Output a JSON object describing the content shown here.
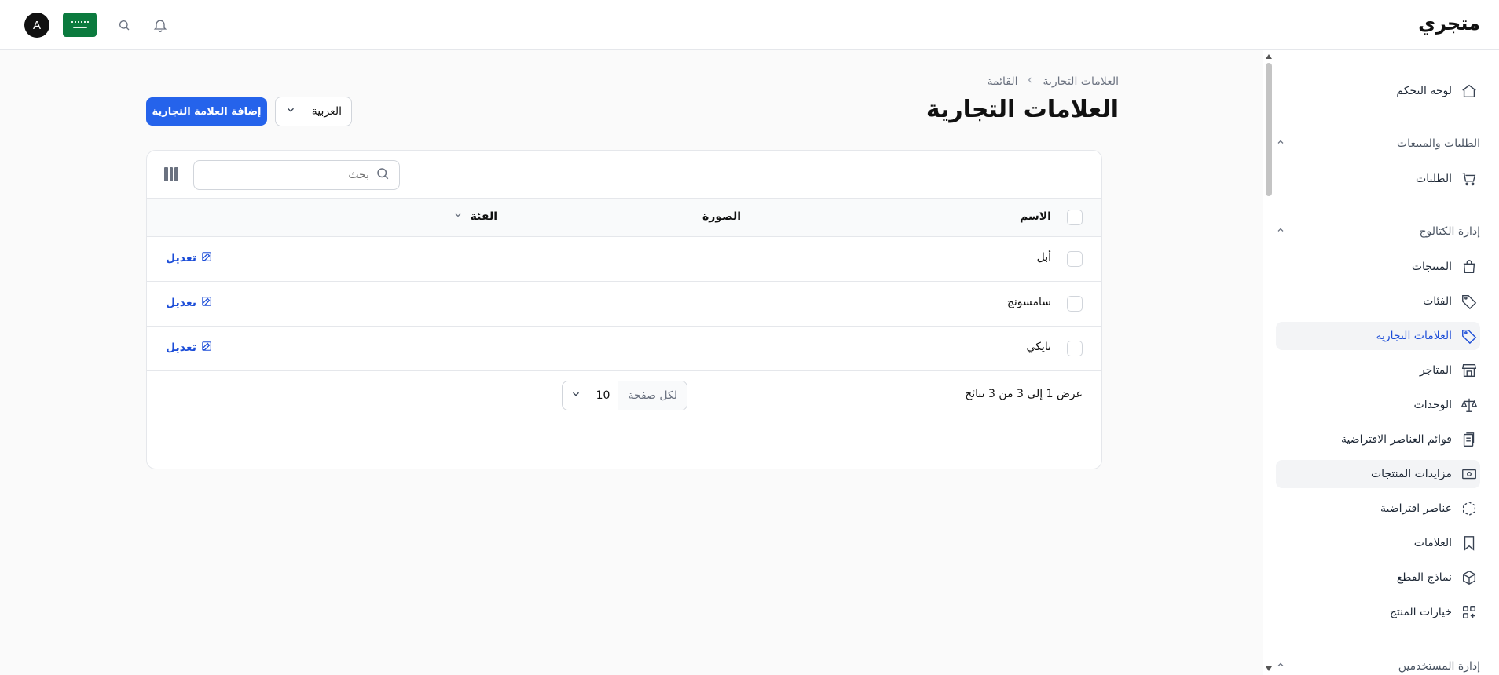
{
  "topbar": {
    "brand": "متجري",
    "avatar_initial": "A",
    "flag": "saudi-flag"
  },
  "sidebar": {
    "items": [
      {
        "label": "لوحة التحكم",
        "icon": "home-icon"
      },
      {
        "group": "الطلبات والمبيعات"
      },
      {
        "label": "الطلبات",
        "icon": "cart-icon"
      },
      {
        "group": "إدارة الكتالوج"
      },
      {
        "label": "المنتجات",
        "icon": "bag-icon"
      },
      {
        "label": "الفئات",
        "icon": "tag-icon"
      },
      {
        "label": "العلامات التجارية",
        "icon": "tag-icon",
        "active": true
      },
      {
        "label": "المتاجر",
        "icon": "store-icon"
      },
      {
        "label": "الوحدات",
        "icon": "scale-icon"
      },
      {
        "label": "قوائم العناصر الافتراضية",
        "icon": "clipboard-icon"
      },
      {
        "label": "مزايدات المنتجات",
        "icon": "money-icon"
      },
      {
        "label": "عناصر افتراضية",
        "icon": "cube-dashed-icon"
      },
      {
        "label": "العلامات",
        "icon": "bookmark-icon"
      },
      {
        "label": "نماذج القطع",
        "icon": "box-icon"
      },
      {
        "label": "خيارات المنتج",
        "icon": "grid-plus-icon"
      },
      {
        "group": "إدارة المستخدمين"
      }
    ]
  },
  "breadcrumb": {
    "parent": "العلامات التجارية",
    "current": "القائمة"
  },
  "page": {
    "title": "العلامات التجارية",
    "add_button": "إضافة العلامة التجارية",
    "language": "العربية"
  },
  "table": {
    "search_placeholder": "بحث",
    "columns": {
      "name": "الاسم",
      "image": "الصورة",
      "category": "الفئة"
    },
    "edit_label": "تعديل",
    "rows": [
      {
        "name": "أبل"
      },
      {
        "name": "سامسونج"
      },
      {
        "name": "نايكي"
      }
    ],
    "footer": {
      "results": "عرض 1 إلى 3 من 3 نتائج",
      "per_page_label": "لكل صفحة",
      "per_page_value": "10"
    }
  },
  "colors": {
    "accent": "#2563eb",
    "link": "#1d4ed8"
  }
}
